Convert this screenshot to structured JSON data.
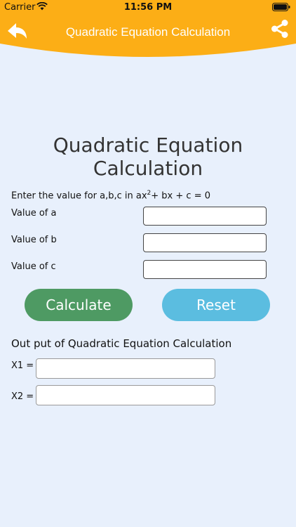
{
  "status_bar": {
    "carrier": "Carrier",
    "time": "11:56 PM"
  },
  "nav": {
    "title": "Quadratic Equation Calculation"
  },
  "colors": {
    "header": "#fcae16",
    "background": "#e8f0fc",
    "calculate_button": "#4e9a63",
    "reset_button": "#5bbde0"
  },
  "icons": {
    "back": "back-arrow-icon",
    "share": "share-icon"
  },
  "main": {
    "title": "Quadratic Equation Calculation",
    "instruction_prefix": "Enter the value for a,b,c in ax",
    "instruction_exponent": "2",
    "instruction_suffix": "+ bx + c = 0",
    "inputs": [
      {
        "label": "Value of a",
        "value": ""
      },
      {
        "label": "Value of b",
        "value": ""
      },
      {
        "label": "Value of c",
        "value": ""
      }
    ],
    "calculate_label": "Calculate",
    "reset_label": "Reset"
  },
  "output": {
    "title": "Out put of Quadratic Equation Calculation",
    "x1_label": "X1 =",
    "x1_value": "",
    "x2_label": "X2 =",
    "x2_value": ""
  }
}
